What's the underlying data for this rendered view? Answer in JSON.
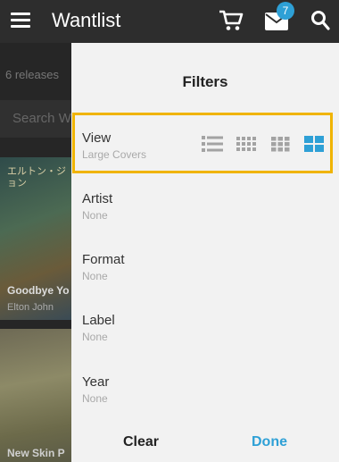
{
  "appbar": {
    "title": "Wantlist",
    "badge_count": "7",
    "icons": [
      "hamburger-menu-icon",
      "cart-icon",
      "mail-icon",
      "search-icon"
    ]
  },
  "background": {
    "release_count": "6 releases",
    "search_placeholder": "Search W",
    "covers": [
      {
        "title": "Goodbye Yo",
        "artist": "Elton John",
        "cover_text": "エルトン・ジョン"
      },
      {
        "title": "New Skin P"
      }
    ]
  },
  "filters": {
    "title": "Filters",
    "rows": [
      {
        "label": "View",
        "value": "Large Covers"
      },
      {
        "label": "Artist",
        "value": "None"
      },
      {
        "label": "Format",
        "value": "None"
      },
      {
        "label": "Label",
        "value": "None"
      },
      {
        "label": "Year",
        "value": "None"
      }
    ],
    "view_options": [
      "list-view-icon",
      "small-grid-icon",
      "medium-grid-icon",
      "large-covers-icon"
    ],
    "selected_view": "large-covers-icon",
    "clear_label": "Clear",
    "done_label": "Done"
  },
  "colors": {
    "accent": "#2ea0d6",
    "highlight": "#f0b400",
    "icon_gray": "#a3a3a3",
    "appbar": "#2d2d2d"
  }
}
